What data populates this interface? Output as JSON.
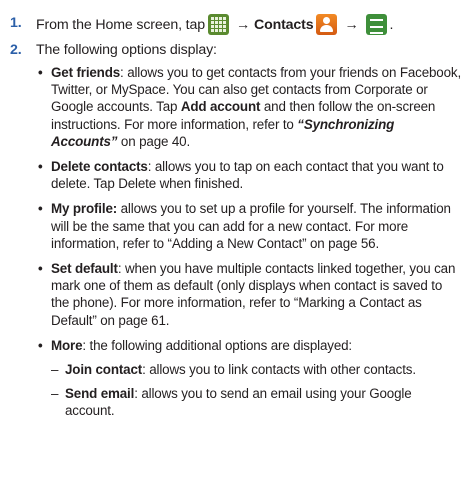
{
  "step1": {
    "number": "1.",
    "prefix": "From the Home screen, tap",
    "arrow": "→",
    "contacts_label": "Contacts",
    "period": "."
  },
  "step2": {
    "number": "2.",
    "text": "The following options display:"
  },
  "options": [
    {
      "title": "Get friends",
      "text_a": ": allows you to get contacts from your friends on Facebook, Twitter, or MySpace. You can also get contacts from Corporate or Google accounts. Tap ",
      "bold_b": "Add account",
      "text_c": " and then follow the on-screen instructions. For more information, refer to ",
      "italic_ref": "“Synchronizing Accounts”",
      "text_d": " on page 40."
    },
    {
      "title": "Delete contacts",
      "text": ": allows you to tap on each contact that you want to delete. Tap Delete when finished."
    },
    {
      "title": "My profile:",
      "text": " allows you to set up a profile for yourself. The information will be the same that you can add for a new contact. For more information, refer to “Adding a New Contact” on page 56."
    },
    {
      "title": "Set default",
      "text": ": when you have multiple contacts linked together, you can mark one of them as default (only displays when contact is saved to the phone). For more information, refer to “Marking a Contact as Default” on page 61."
    },
    {
      "title": "More",
      "text": ": the following additional options are displayed:"
    }
  ],
  "more_options": [
    {
      "title": "Join contact",
      "text": ": allows you to link contacts with other contacts."
    },
    {
      "title": "Send email",
      "text": ": allows you to send an email using your Google account."
    }
  ],
  "icons": {
    "apps": "apps-grid-icon",
    "contacts": "contacts-app-icon",
    "menu": "menu-key-icon"
  },
  "colors": {
    "step_number": "#2b5fa8",
    "text": "#231f20"
  }
}
